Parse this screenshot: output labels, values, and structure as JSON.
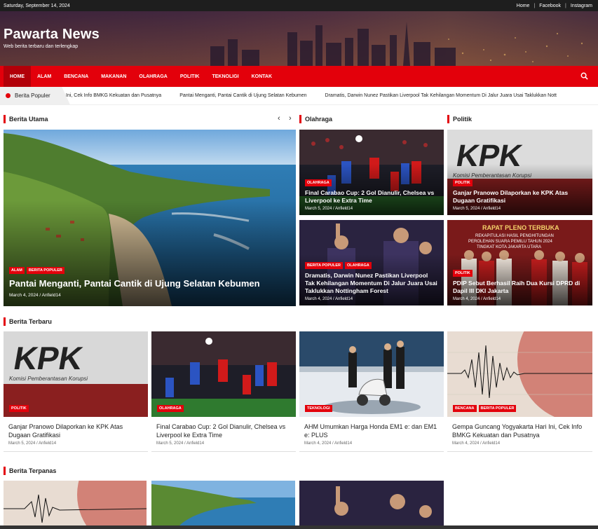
{
  "topbar": {
    "date": "Saturday, September 14, 2024",
    "links": [
      "Home",
      "Facebook",
      "Instagram"
    ],
    "separator": "|"
  },
  "header": {
    "site_title": "Pawarta News",
    "tagline": "Web berita terbaru dan terlengkap"
  },
  "nav": {
    "items": [
      "HOME",
      "ALAM",
      "BENCANA",
      "MAKANAN",
      "OLAHRAGA",
      "POLITIK",
      "TEKNOLIGI",
      "KONTAK"
    ],
    "search_icon": "search-icon"
  },
  "ticker": {
    "label": "Berita Populer",
    "items": [
      "Ini, Cek Info BMKG Kekuatan dan Pusatnya",
      "Pantai Menganti, Pantai Cantik di Ujung Selatan Kebumen",
      "Dramatis, Darwin Nunez Pastikan Liverpool Tak Kehilangan Momentum Di Jalur Juara Usai Taklukkan Nott"
    ]
  },
  "sections": {
    "utama": "Berita Utama",
    "olahraga": "Olahraga",
    "politik": "Politik",
    "terbaru": "Berita Terbaru",
    "terpanas": "Berita Terpanas"
  },
  "slider_arrows": {
    "prev": "‹",
    "next": "›"
  },
  "featured": {
    "badges": [
      "ALAM",
      "BERITA POPULER"
    ],
    "title": "Pantai Menganti, Pantai Cantik di Ujung Selatan Kebumen",
    "meta": "March 4, 2024 / Anfield14"
  },
  "olahraga": [
    {
      "badges": [
        "OLAHRAGA"
      ],
      "title": "Final Carabao Cup: 2 Gol Dianulir, Chelsea vs Liverpool ke Extra Time",
      "meta": "March 5, 2024 / Anfield14"
    },
    {
      "badges": [
        "BERITA POPULER",
        "OLAHRAGA"
      ],
      "title": "Dramatis, Darwin Nunez Pastikan Liverpool Tak Kehilangan Momentum Di Jalur Juara Usai Taklukkan Nottingham Forest",
      "meta": "March 4, 2024 / Anfield14"
    }
  ],
  "politik": [
    {
      "badges": [
        "POLITIK"
      ],
      "title": "Ganjar Pranowo Dilaporkan ke KPK Atas Dugaan Gratifikasi",
      "meta": "March 5, 2024 / Anfield14"
    },
    {
      "badges": [
        "POLITIK"
      ],
      "title": "PDIP Sebut Berhasil Raih Dua Kursi DPRD di Dapil III DKI Jakarta",
      "meta": "March 4, 2024 / Anfield14"
    }
  ],
  "terbaru": [
    {
      "badges": [
        "POLITIK"
      ],
      "title": "Ganjar Pranowo Dilaporkan ke KPK Atas Dugaan Gratifikasi",
      "meta": "March 5, 2024 / Anfield14"
    },
    {
      "badges": [
        "OLAHRAGA"
      ],
      "title": "Final Carabao Cup: 2 Gol Dianulir, Chelsea vs Liverpool ke Extra Time",
      "meta": "March 5, 2024 / Anfield14"
    },
    {
      "badges": [
        "TEKNOLOGI"
      ],
      "title": "AHM Umumkan Harga Honda EM1 e: dan EM1 e: PLUS",
      "meta": "March 4, 2024 / Anfield14"
    },
    {
      "badges": [
        "BENCANA",
        "BERITA POPULER"
      ],
      "title": "Gempa Guncang Yogyakarta Hari Ini, Cek Info BMKG Kekuatan dan Pusatnya",
      "meta": "March 4, 2024 / Anfield14"
    }
  ],
  "images": {
    "kpk_text": "KPK",
    "kpk_sub": "Komisi Pemberantasan Korupsi",
    "pleno_title": "RAPAT PLENO TERBUKA",
    "pleno_sub1": "REKAPITULASI HASIL PENGHITUNGAN",
    "pleno_sub2": "PEROLEHAN SUARA PEMILU TAHUN 2024",
    "pleno_sub3": "TINGKAT KOTA JAKARTA UTARA"
  },
  "colors": {
    "accent": "#e3000b",
    "topbar": "#1e1e1e"
  }
}
